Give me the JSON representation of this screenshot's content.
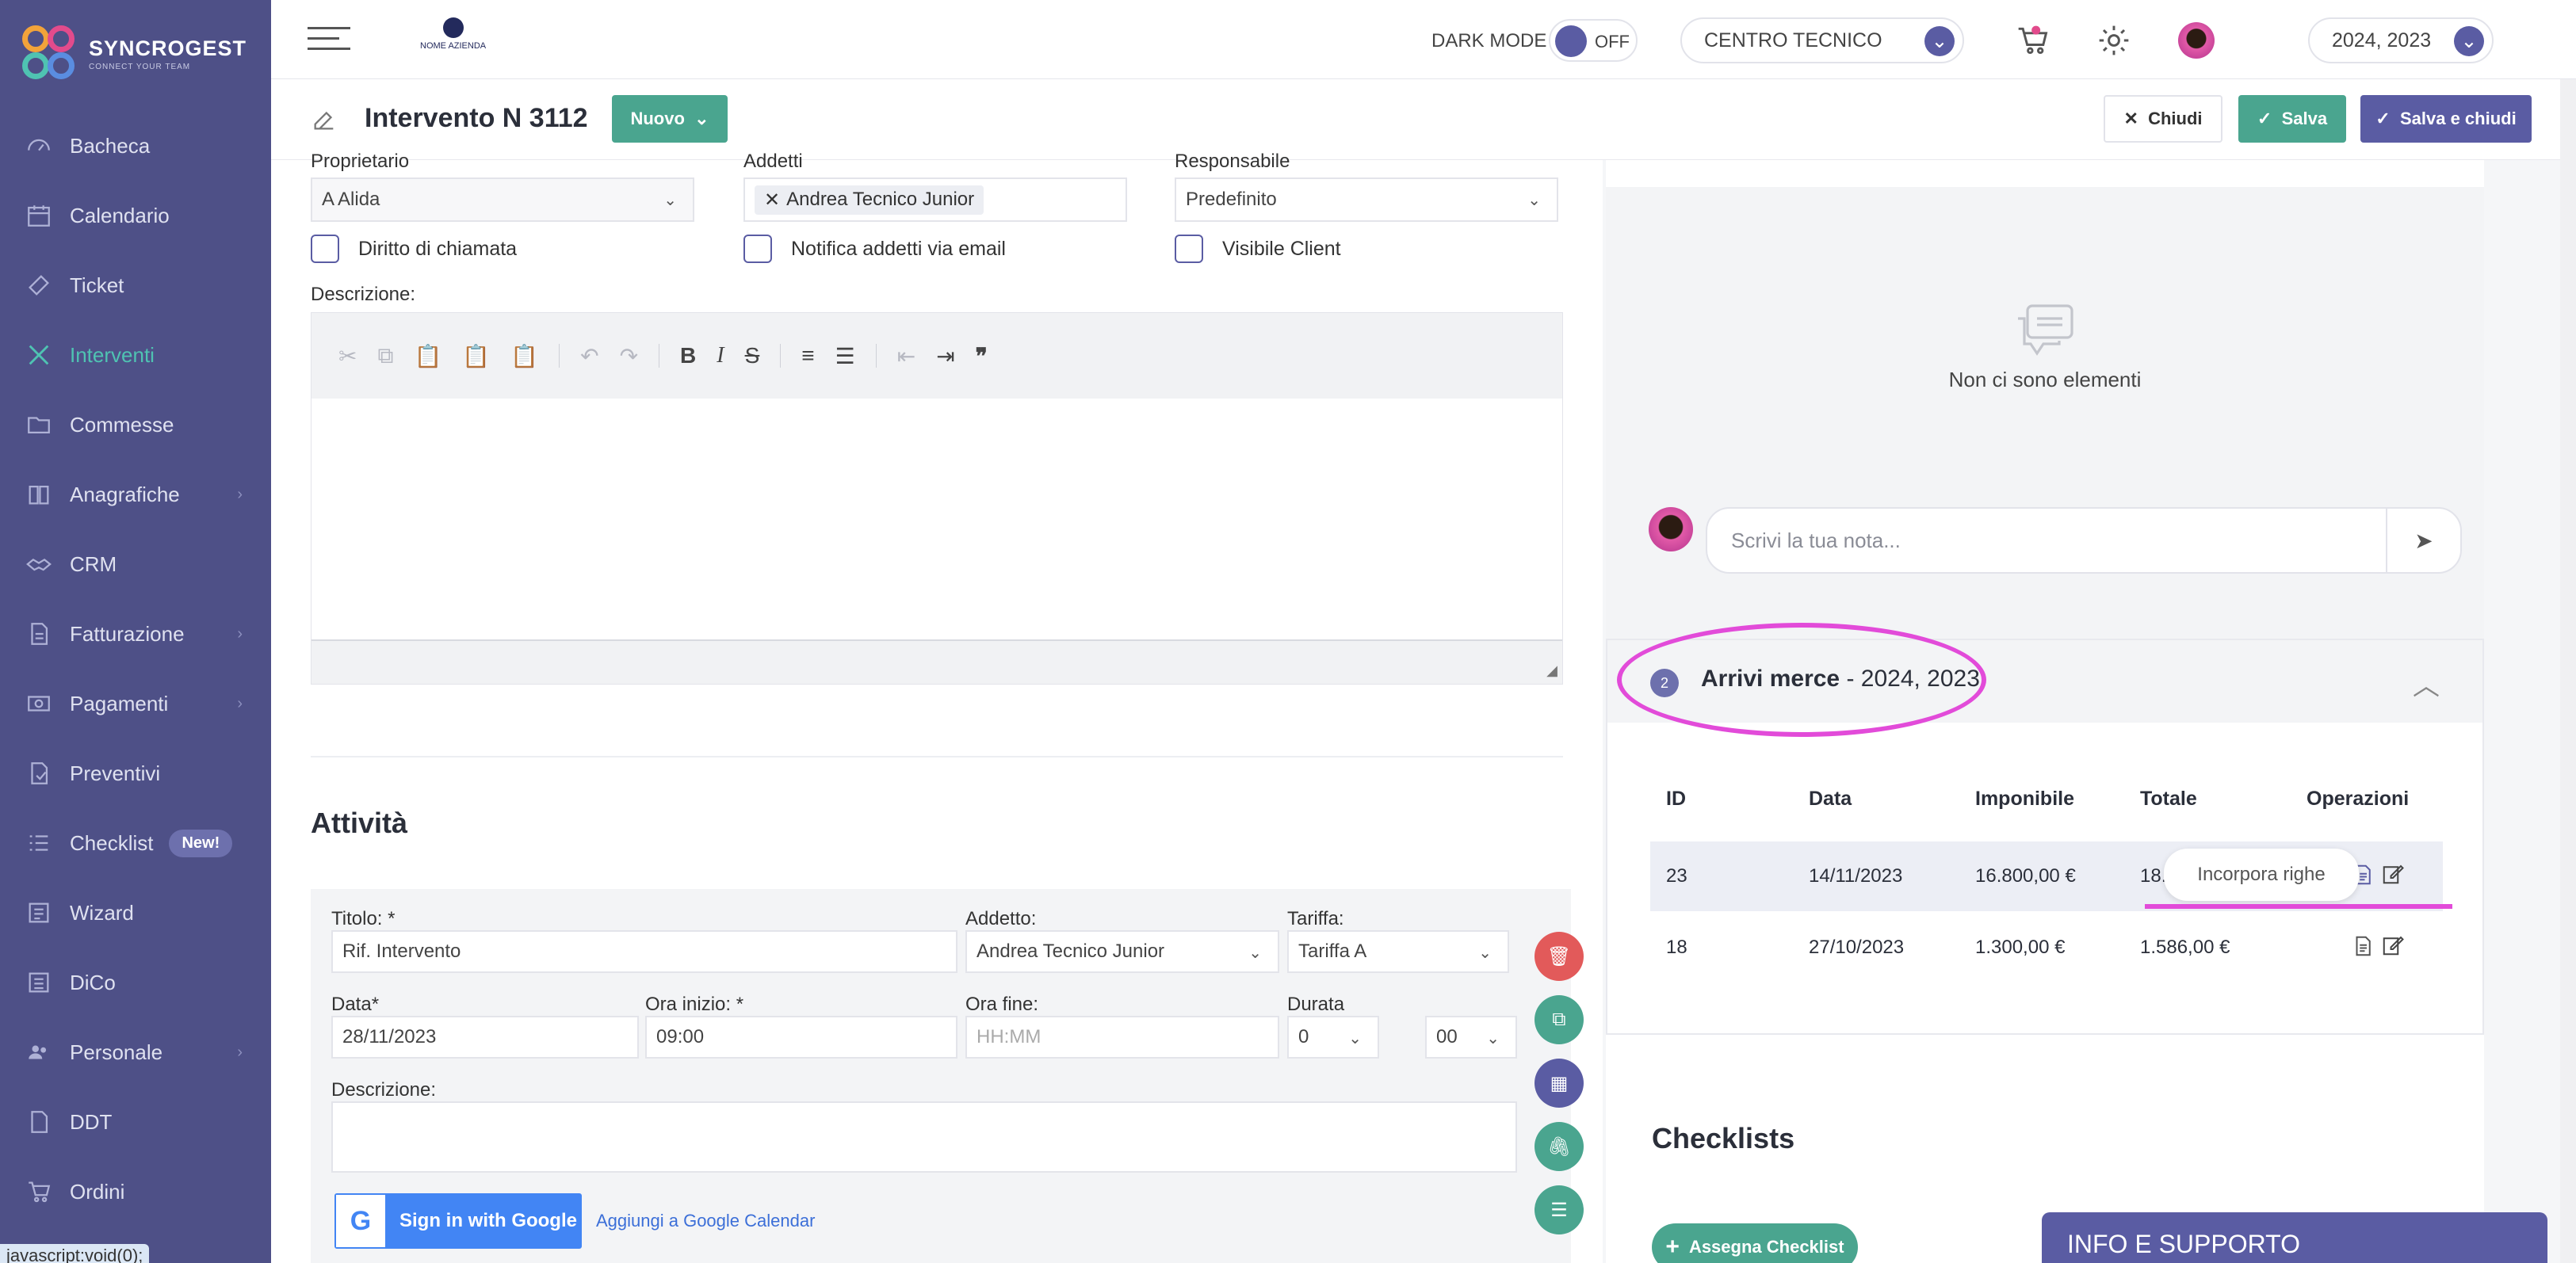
{
  "app": {
    "brand": "SYNCROGEST",
    "tagline": "CONNECT YOUR TEAM",
    "company_logo_text": "NOME AZIENDA"
  },
  "sidebar": {
    "items": [
      {
        "label": "Bacheca",
        "icon": "dashboard-icon",
        "has_chevron": false
      },
      {
        "label": "Calendario",
        "icon": "calendar-icon",
        "has_chevron": false
      },
      {
        "label": "Ticket",
        "icon": "ticket-icon",
        "has_chevron": false
      },
      {
        "label": "Interventi",
        "icon": "tools-icon",
        "has_chevron": false,
        "active": true
      },
      {
        "label": "Commesse",
        "icon": "folder-icon",
        "has_chevron": false
      },
      {
        "label": "Anagrafiche",
        "icon": "book-icon",
        "has_chevron": true
      },
      {
        "label": "CRM",
        "icon": "handshake-icon",
        "has_chevron": false
      },
      {
        "label": "Fatturazione",
        "icon": "invoice-icon",
        "has_chevron": true
      },
      {
        "label": "Pagamenti",
        "icon": "payments-icon",
        "has_chevron": true
      },
      {
        "label": "Preventivi",
        "icon": "quote-icon",
        "has_chevron": false
      },
      {
        "label": "Checklist",
        "icon": "checklist-icon",
        "has_chevron": false,
        "badge": "New!"
      },
      {
        "label": "Wizard",
        "icon": "wizard-icon",
        "has_chevron": false
      },
      {
        "label": "DiCo",
        "icon": "document-icon",
        "has_chevron": false
      },
      {
        "label": "Personale",
        "icon": "people-icon",
        "has_chevron": true
      },
      {
        "label": "DDT",
        "icon": "ddt-icon",
        "has_chevron": false
      },
      {
        "label": "Ordini",
        "icon": "cart-icon",
        "has_chevron": false
      }
    ],
    "status_text": "javascript:void(0);"
  },
  "topbar": {
    "dark_mode_label": "DARK MODE",
    "dark_mode_state": "OFF",
    "center_select": "CENTRO TECNICO",
    "year_select": "2024, 2023"
  },
  "subheader": {
    "title": "Intervento N 3112",
    "nuovo_label": "Nuovo",
    "chiudi_label": "Chiudi",
    "salva_label": "Salva",
    "salva_chiudi_label": "Salva e chiudi"
  },
  "form": {
    "proprietario_label": "Proprietario",
    "proprietario_value": "A Alida",
    "addetti_label": "Addetti",
    "addetti_tag": "Andrea Tecnico Junior",
    "responsabile_label": "Responsabile",
    "responsabile_value": "Predefinito",
    "chk_diritto": "Diritto di chiamata",
    "chk_notifica": "Notifica addetti via email",
    "chk_visibile": "Visibile Client",
    "descrizione_label": "Descrizione:"
  },
  "attivita": {
    "section_title": "Attività",
    "titolo_label": "Titolo: *",
    "titolo_value": "Rif. Intervento",
    "addetto_label": "Addetto:",
    "addetto_value": "Andrea Tecnico Junior",
    "tariffa_label": "Tariffa:",
    "tariffa_value": "Tariffa A",
    "data_label": "Data*",
    "data_value": "28/11/2023",
    "ora_inizio_label": "Ora inizio: *",
    "ora_inizio_value": "09:00",
    "ora_fine_label": "Ora fine:",
    "ora_fine_placeholder": "HH:MM",
    "durata_label": "Durata",
    "durata_h": "0",
    "durata_m": "00",
    "descrizione_label": "Descrizione:",
    "google_btn": "Sign in with Google",
    "google_link": "Aggiungi a Google Calendar"
  },
  "notes": {
    "empty_text": "Non ci sono elementi",
    "placeholder": "Scrivi la tua nota..."
  },
  "arrivi": {
    "count": "2",
    "title_bold": "Arrivi merce",
    "title_rest": " - 2024, 2023",
    "columns": [
      "ID",
      "Data",
      "Imponibile",
      "Totale",
      "Operazioni"
    ],
    "rows": [
      {
        "id": "23",
        "data": "14/11/2023",
        "imponibile": "16.800,00 €",
        "totale": "18."
      },
      {
        "id": "18",
        "data": "27/10/2023",
        "imponibile": "1.300,00 €",
        "totale": "1.586,00 €"
      }
    ],
    "tooltip": "Incorpora righe"
  },
  "checklists": {
    "title": "Checklists",
    "assign_btn": "Assegna Checklist"
  },
  "info_box": "INFO E SUPPORTO",
  "colors": {
    "sidebar_bg": "#4e5087",
    "accent_green": "#4aa58f",
    "accent_purple": "#5a5ca3",
    "annotation_magenta": "#e24bd9"
  }
}
